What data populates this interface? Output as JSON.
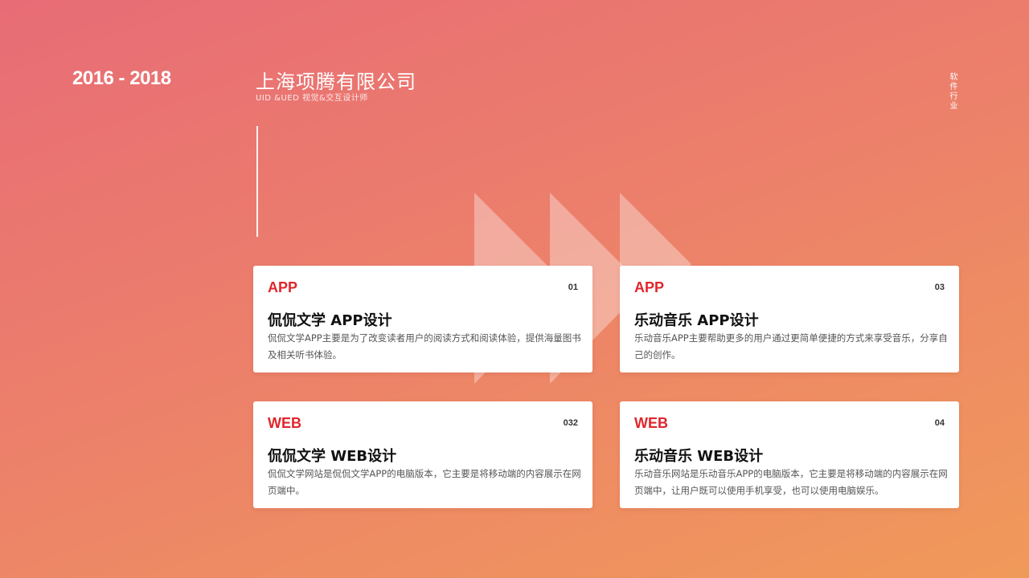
{
  "header": {
    "years": "2016 - 2018",
    "company": "上海项腾有限公司",
    "subtitle": "UID &UED 视觉&交互设计师",
    "industry": "软件行业"
  },
  "cards": [
    {
      "tag": "APP",
      "num": "01",
      "title": "侃侃文学 APP设计",
      "desc": "侃侃文学APP主要是为了改变读者用户的阅读方式和阅读体验，提供海量图书及相关听书体验。"
    },
    {
      "tag": "APP",
      "num": "03",
      "title": "乐动音乐 APP设计",
      "desc": "乐动音乐APP主要帮助更多的用户通过更简单便捷的方式来享受音乐，分享自己的创作。"
    },
    {
      "tag": "WEB",
      "num": "032",
      "title": "侃侃文学 WEB设计",
      "desc": "侃侃文学网站是侃侃文学APP的电脑版本，它主要是将移动端的内容展示在网页端中。"
    },
    {
      "tag": "WEB",
      "num": "04",
      "title": "乐动音乐 WEB设计",
      "desc": "乐动音乐网站是乐动音乐APP的电脑版本，它主要是将移动端的内容展示在网页端中，让用户既可以使用手机享受，也可以使用电脑娱乐。"
    }
  ],
  "colors": {
    "accent": "#e0262c",
    "gradient_start": "#e86c76",
    "gradient_end": "#f09a5a"
  }
}
